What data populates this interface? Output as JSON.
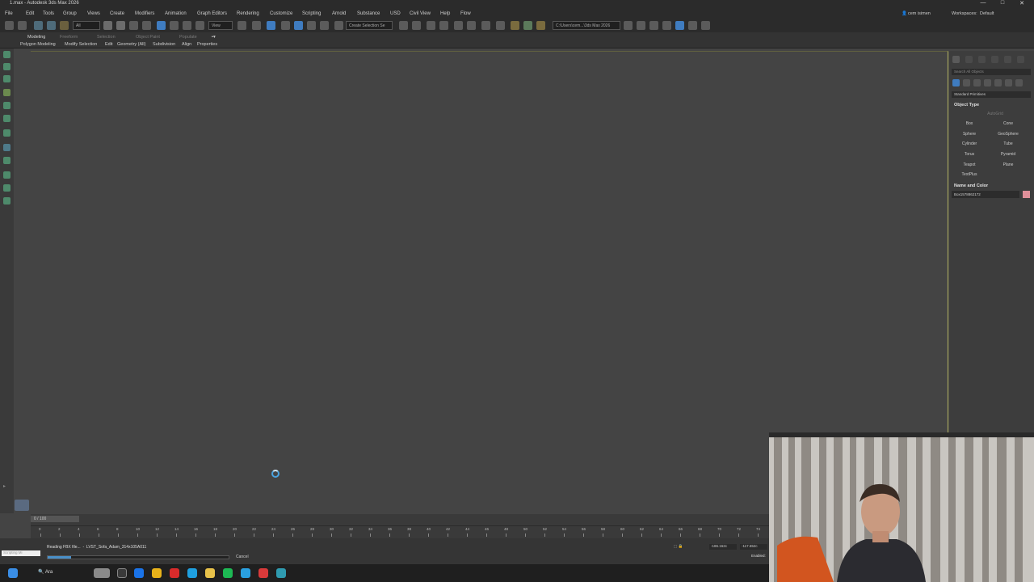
{
  "window": {
    "title": "1.max - Autodesk 3ds Max 2026",
    "controls": [
      "—",
      "□",
      "✕"
    ]
  },
  "menubar": {
    "items": [
      "File",
      "Edit",
      "Tools",
      "Group",
      "Views",
      "Create",
      "Modifiers",
      "Animation",
      "Graph Editors",
      "Rendering",
      "Customize",
      "Scripting",
      "Arnold",
      "Substance",
      "USD",
      "Civil View",
      "Help",
      "Flow"
    ],
    "user": "cem isimen",
    "workspaces_label": "Workspaces:",
    "workspace_value": "Default"
  },
  "toolbar": {
    "filter_value": "All",
    "view_value": "View",
    "selection_set_placeholder": "Create Selection Se",
    "path_value": "C:\\Users\\cem...\\3ds Max 2026"
  },
  "ribbon": {
    "tabs": [
      "Modeling",
      "Freeform",
      "Selection",
      "Object Paint",
      "Populate"
    ],
    "subtabs": [
      "Polygon Modeling",
      "Modify Selection",
      "Edit",
      "Geometry (All)",
      "Subdivision",
      "Align",
      "Properties"
    ]
  },
  "command_panel": {
    "search_placeholder": "Search All Objects",
    "category": "Standard Primitives",
    "object_type_title": "Object Type",
    "autogrid": "AutoGrid",
    "primitives": [
      [
        "Box",
        "Cone"
      ],
      [
        "Sphere",
        "GeoSphere"
      ],
      [
        "Cylinder",
        "Tube"
      ],
      [
        "Torus",
        "Pyramid"
      ],
      [
        "Teapot",
        "Plane"
      ],
      [
        "TextPlus",
        ""
      ]
    ],
    "name_color_title": "Name and Color",
    "object_name": "Box1578862172",
    "object_color": "#e0909a"
  },
  "timeline": {
    "slider_label": "0 / 100",
    "ticks": [
      "0",
      "2",
      "4",
      "6",
      "8",
      "10",
      "12",
      "14",
      "16",
      "18",
      "20",
      "22",
      "24",
      "26",
      "28",
      "30",
      "32",
      "34",
      "36",
      "38",
      "40",
      "42",
      "44",
      "46",
      "48",
      "50",
      "52",
      "54",
      "56",
      "58",
      "60",
      "62",
      "64",
      "66",
      "68",
      "70",
      "72",
      "74"
    ]
  },
  "status": {
    "script_label": "Scripting Mi",
    "message": "Reading FBX file...",
    "file": "LVST_Sofa_Adam_314x105A011",
    "progress": 0.13,
    "cancel_label": "Cancel",
    "x_value": "-186.162c",
    "y_value": "-117.652c",
    "enabled_label": "Enabled:"
  },
  "taskbar": {
    "search_label": "Ara"
  }
}
